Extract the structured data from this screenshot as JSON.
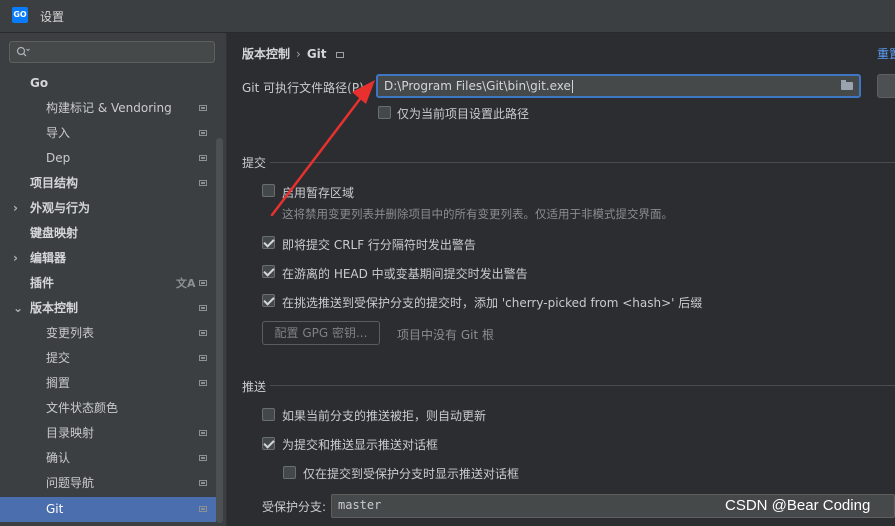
{
  "window": {
    "title": "设置",
    "logo_text": "GO"
  },
  "search": {
    "value": ""
  },
  "sidebar": {
    "items": [
      {
        "label": "Go"
      },
      {
        "label": "构建标记 & Vendoring"
      },
      {
        "label": "导入"
      },
      {
        "label": "Dep"
      },
      {
        "label": "项目结构"
      },
      {
        "label": "外观与行为",
        "arrow": "›"
      },
      {
        "label": "键盘映射"
      },
      {
        "label": "编辑器",
        "arrow": "›"
      },
      {
        "label": "插件",
        "translate_glyph": "文A"
      },
      {
        "label": "版本控制",
        "arrow": "⌄"
      },
      {
        "label": "变更列表"
      },
      {
        "label": "提交"
      },
      {
        "label": "搁置"
      },
      {
        "label": "文件状态颜色"
      },
      {
        "label": "目录映射"
      },
      {
        "label": "确认"
      },
      {
        "label": "问题导航"
      },
      {
        "label": "Git",
        "selected": true
      }
    ]
  },
  "main": {
    "breadcrumb": {
      "parent": "版本控制",
      "separator": "›",
      "current": "Git"
    },
    "reset_label": "重置",
    "git_path": {
      "label": "Git 可执行文件路径(P):",
      "value": "D:\\Program Files\\Git\\bin\\git.exe",
      "project_only_label": "仅为当前项目设置此路径",
      "project_only_checked": false
    },
    "commit": {
      "title": "提交",
      "staging_label": "启用暂存区域",
      "staging_checked": false,
      "staging_hint": "这将禁用变更列表并删除项目中的所有变更列表。仅适用于非模式提交界面。",
      "crlf_label": "即将提交 CRLF 行分隔符时发出警告",
      "crlf_checked": true,
      "detached_label": "在游离的 HEAD 中或变基期间提交时发出警告",
      "detached_checked": true,
      "cherry_label": "在挑选推送到受保护分支的提交时，添加 'cherry-picked from <hash>' 后缀",
      "cherry_checked": true,
      "gpg_button": "配置 GPG 密钥...",
      "gpg_hint": "项目中没有 Git 根"
    },
    "push": {
      "title": "推送",
      "auto_update_label": "如果当前分支的推送被拒，则自动更新",
      "auto_update_checked": false,
      "show_dialog_label": "为提交和推送显示推送对话框",
      "show_dialog_checked": true,
      "protected_only_label": "仅在提交到受保护分支时显示推送对话框",
      "protected_only_checked": false,
      "protected_branches_label": "受保护分支:",
      "protected_branches_value": "master"
    }
  },
  "watermark": "CSDN @Bear Coding",
  "colors": {
    "accent": "#4b6eaf",
    "focus_border": "#3d77c4",
    "annotation_arrow": "#e8312f",
    "link": "#589df6"
  }
}
